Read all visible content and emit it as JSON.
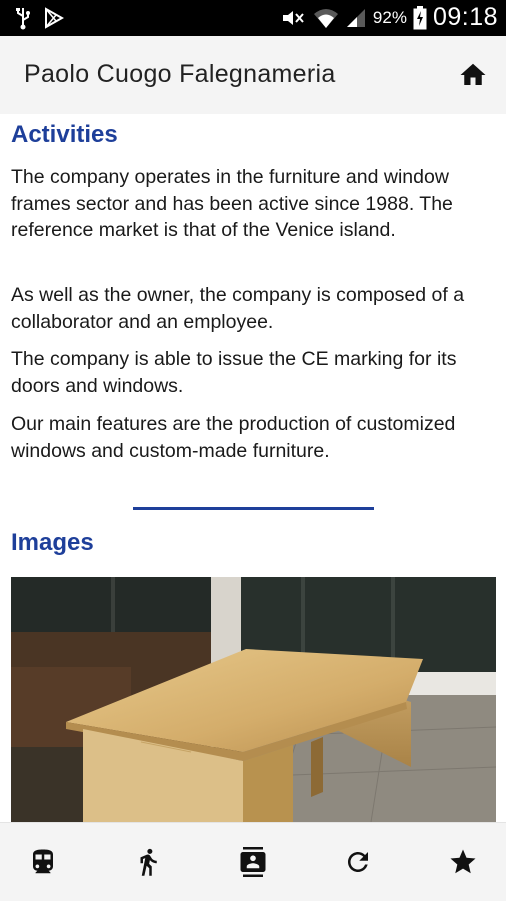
{
  "status_bar": {
    "battery_percent": "92%",
    "time": "09:18",
    "left_icons": [
      "usb-icon",
      "play-store-icon"
    ],
    "right_icons": [
      "mute-icon",
      "wifi-icon",
      "signal-icon",
      "battery-charging-icon"
    ]
  },
  "app_bar": {
    "title": "Paolo Cuogo Falegnameria",
    "home_icon": "home-icon"
  },
  "activities": {
    "heading": "Activities",
    "paragraphs": [
      "The company operates in the furniture and window frames sector and has been active since 1988. The reference market is that of the Venice island.",
      "As well as the owner, the company is composed of a collaborator and an employee.",
      "The company is able to issue the CE marking for its doors and windows.",
      "Our main features are the production of customized windows and custom-made furniture."
    ]
  },
  "images": {
    "heading": "Images",
    "photo_subject": "wooden-table-photo"
  },
  "bottom_nav": {
    "items": [
      "train-icon",
      "walk-icon",
      "contacts-icon",
      "refresh-icon",
      "star-icon"
    ]
  },
  "colors": {
    "accent": "#1e3f9a",
    "status_bar": "#000000",
    "app_bar": "#f4f4f4"
  }
}
